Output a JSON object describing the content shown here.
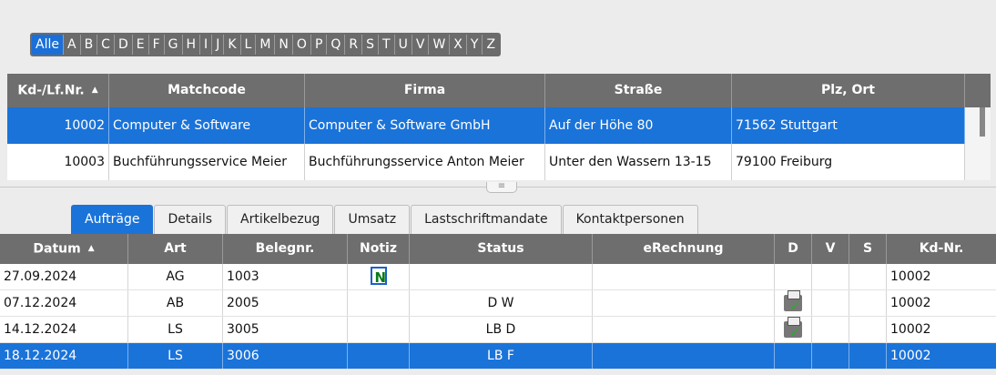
{
  "alphabet": [
    "Alle",
    "A",
    "B",
    "C",
    "D",
    "E",
    "F",
    "G",
    "H",
    "I",
    "J",
    "K",
    "L",
    "M",
    "N",
    "O",
    "P",
    "Q",
    "R",
    "S",
    "T",
    "U",
    "V",
    "W",
    "X",
    "Y",
    "Z"
  ],
  "top_table": {
    "headers": [
      "Kd-/Lf.Nr.",
      "Matchcode",
      "Firma",
      "Straße",
      "Plz, Ort"
    ],
    "rows": [
      {
        "nr": "10002",
        "matchcode": "Computer & Software",
        "firma": "Computer & Software GmbH",
        "strasse": "Auf der Höhe 80",
        "ort": "71562 Stuttgart"
      },
      {
        "nr": "10003",
        "matchcode": "Buchführungsservice Meier",
        "firma": "Buchführungsservice Anton Meier",
        "strasse": "Unter den Wassern 13-15",
        "ort": "79100 Freiburg"
      }
    ]
  },
  "splitter_glyph": "≡",
  "tabs": [
    "Aufträge",
    "Details",
    "Artikelbezug",
    "Umsatz",
    "Lastschriftmandate",
    "Kontaktpersonen"
  ],
  "bottom_table": {
    "headers": [
      "Datum",
      "Art",
      "Belegnr.",
      "Notiz",
      "Status",
      "eRechnung",
      "D",
      "V",
      "S",
      "Kd-Nr."
    ],
    "rows": [
      {
        "datum": "27.09.2024",
        "art": "AG",
        "belegnr": "1003",
        "notiz": "note-icon",
        "status": "",
        "erechnung": "",
        "d": "",
        "v": "",
        "s": "",
        "kdnr": "10002"
      },
      {
        "datum": "07.12.2024",
        "art": "AB",
        "belegnr": "2005",
        "notiz": "",
        "status": "D W",
        "erechnung": "",
        "d": "printer-icon",
        "v": "",
        "s": "",
        "kdnr": "10002"
      },
      {
        "datum": "14.12.2024",
        "art": "LS",
        "belegnr": "3005",
        "notiz": "",
        "status": "LB D",
        "erechnung": "",
        "d": "printer-icon",
        "v": "",
        "s": "",
        "kdnr": "10002"
      },
      {
        "datum": "18.12.2024",
        "art": "LS",
        "belegnr": "3006",
        "notiz": "",
        "status": "LB F",
        "erechnung": "",
        "d": "",
        "v": "",
        "s": "",
        "kdnr": "10002"
      }
    ]
  },
  "colors": {
    "accent": "#1a73d9",
    "header_bg": "#6e6e6e"
  }
}
